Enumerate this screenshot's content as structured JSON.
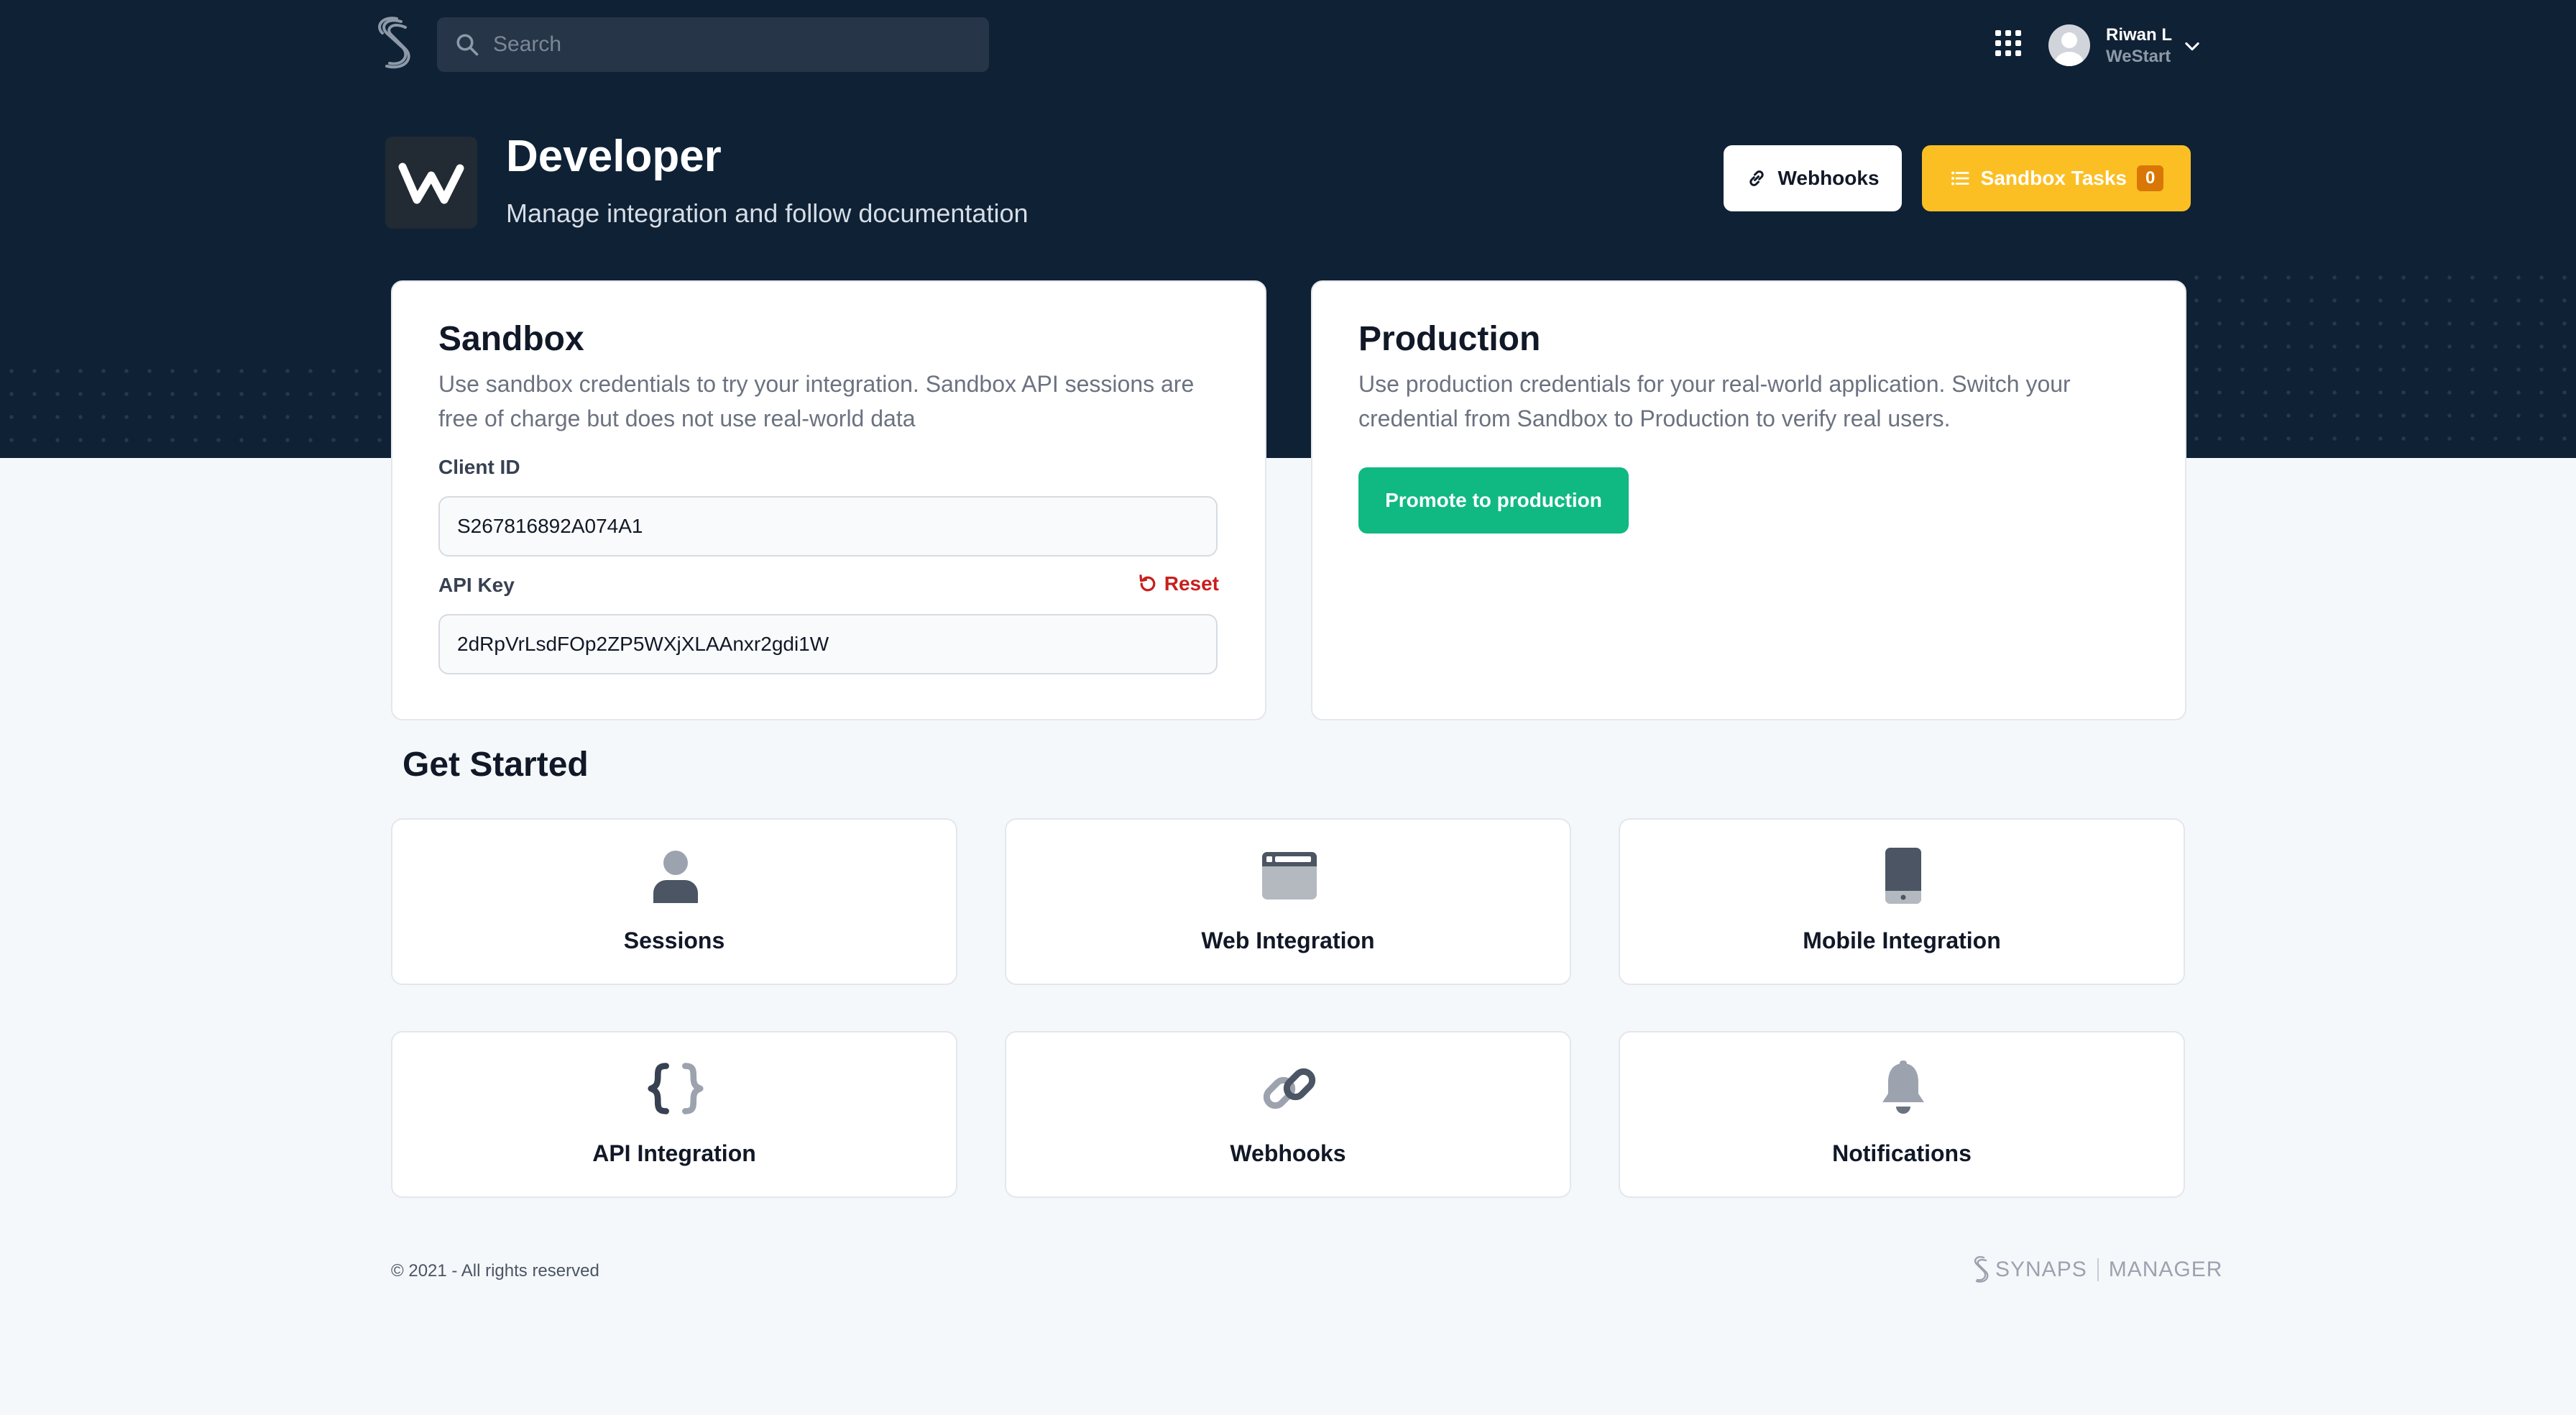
{
  "topbar": {
    "search_placeholder": "Search",
    "user_name": "Riwan L",
    "user_org": "WeStart"
  },
  "header": {
    "title": "Developer",
    "subtitle": "Manage integration and follow documentation",
    "webhooks_label": "Webhooks",
    "sandbox_tasks_label": "Sandbox Tasks",
    "sandbox_tasks_count": "0"
  },
  "sandbox": {
    "title": "Sandbox",
    "description": "Use sandbox credentials to try your integration. Sandbox API sessions are free of charge but does not use real-world data",
    "client_id_label": "Client ID",
    "client_id_value": "S267816892A074A1",
    "api_key_label": "API Key",
    "api_key_value": "2dRpVrLsdFOp2ZP5WXjXLAAnxr2gdi1W",
    "reset_label": "Reset"
  },
  "production": {
    "title": "Production",
    "description": "Use production credentials for your real-world application. Switch your credential from Sandbox to Production to verify real users.",
    "promote_label": "Promote to production"
  },
  "get_started": {
    "title": "Get Started",
    "tiles": [
      {
        "label": "Sessions",
        "icon": "user-icon"
      },
      {
        "label": "Web Integration",
        "icon": "browser-window-icon"
      },
      {
        "label": "Mobile Integration",
        "icon": "mobile-phone-icon"
      },
      {
        "label": "API Integration",
        "icon": "code-braces-icon"
      },
      {
        "label": "Webhooks",
        "icon": "link-icon"
      },
      {
        "label": "Notifications",
        "icon": "bell-icon"
      }
    ]
  },
  "footer": {
    "copyright": "© 2021 - All rights reserved",
    "brand": "SYNAPS",
    "product": "MANAGER"
  },
  "colors": {
    "hero_bg": "#0f2135",
    "accent_yellow": "#fbbf24",
    "accent_green": "#10b981",
    "danger_red": "#c81e1e"
  }
}
